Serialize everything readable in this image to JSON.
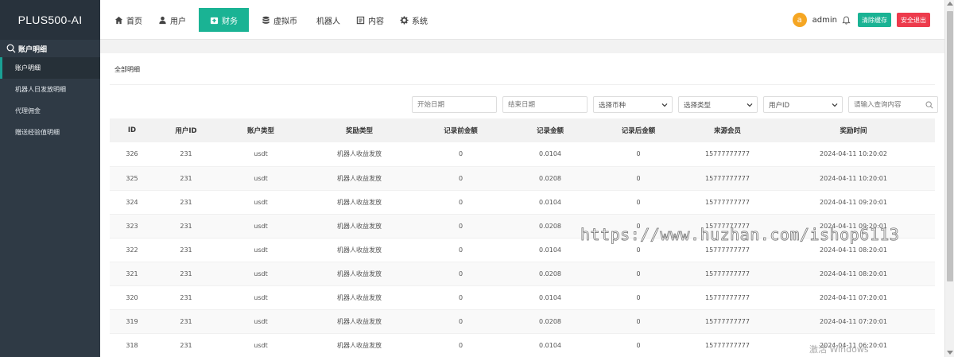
{
  "brand": "PLUS500-AI",
  "sidebar": {
    "header": "账户明细",
    "items": [
      {
        "label": "账户明细",
        "active": true
      },
      {
        "label": "机器人日发放明细",
        "active": false
      },
      {
        "label": "代理佣金",
        "active": false
      },
      {
        "label": "赠送经验值明细",
        "active": false
      }
    ]
  },
  "nav": {
    "items": [
      {
        "label": "首页",
        "icon": "home-icon"
      },
      {
        "label": "用户",
        "icon": "user-icon"
      },
      {
        "label": "财务",
        "icon": "wallet-icon",
        "active": true
      },
      {
        "label": "虚拟币",
        "icon": "database-icon"
      },
      {
        "label": "机器人",
        "icon": ""
      },
      {
        "label": "内容",
        "icon": "document-icon"
      },
      {
        "label": "系统",
        "icon": "gear-icon"
      }
    ]
  },
  "user": {
    "avatar_letter": "a",
    "name": "admin",
    "clear_cache": "清除缓存",
    "logout": "安全退出"
  },
  "panel": {
    "title": "全部明细"
  },
  "filters": {
    "start_date_placeholder": "开始日期",
    "end_date_placeholder": "结束日期",
    "currency": "选择币种",
    "type": "选择类型",
    "user_field": "用户ID",
    "search_placeholder": "请输入查询内容"
  },
  "table": {
    "headers": [
      "ID",
      "用户ID",
      "账户类型",
      "奖励类型",
      "记录前金额",
      "记录金额",
      "记录后金额",
      "来源会员",
      "奖励时间"
    ],
    "rows": [
      [
        "326",
        "231",
        "usdt",
        "机器人收益发放",
        "0",
        "0.0104",
        "0",
        "15777777777",
        "2024-04-11 10:20:02"
      ],
      [
        "325",
        "231",
        "usdt",
        "机器人收益发放",
        "0",
        "0.0208",
        "0",
        "15777777777",
        "2024-04-11 10:20:01"
      ],
      [
        "324",
        "231",
        "usdt",
        "机器人收益发放",
        "0",
        "0.0104",
        "0",
        "15777777777",
        "2024-04-11 09:20:01"
      ],
      [
        "323",
        "231",
        "usdt",
        "机器人收益发放",
        "0",
        "0.0208",
        "0",
        "15777777777",
        "2024-04-11 09:20:01"
      ],
      [
        "322",
        "231",
        "usdt",
        "机器人收益发放",
        "0",
        "0.0104",
        "0",
        "15777777777",
        "2024-04-11 08:20:01"
      ],
      [
        "321",
        "231",
        "usdt",
        "机器人收益发放",
        "0",
        "0.0208",
        "0",
        "15777777777",
        "2024-04-11 08:20:01"
      ],
      [
        "320",
        "231",
        "usdt",
        "机器人收益发放",
        "0",
        "0.0104",
        "0",
        "15777777777",
        "2024-04-11 07:20:01"
      ],
      [
        "319",
        "231",
        "usdt",
        "机器人收益发放",
        "0",
        "0.0208",
        "0",
        "15777777777",
        "2024-04-11 07:20:01"
      ],
      [
        "318",
        "231",
        "usdt",
        "机器人收益发放",
        "0",
        "0.0104",
        "0",
        "15777777777",
        "2024-04-11 06:20:01"
      ]
    ]
  },
  "watermark": "https://www.huzhan.com/ishop6113",
  "windows_mark": "激活 Windows",
  "colors": {
    "sidebar_bg": "#2f3a45",
    "accent": "#1ab394",
    "danger": "#ed3b4c",
    "avatar": "#f5a623"
  }
}
